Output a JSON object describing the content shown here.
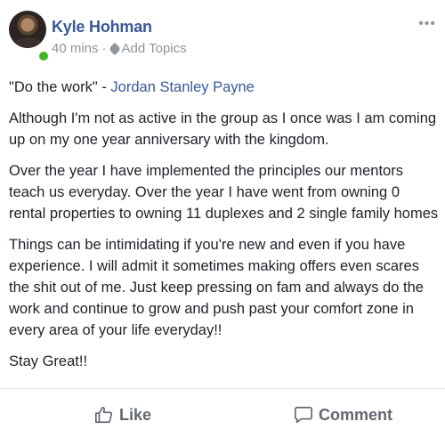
{
  "post": {
    "author": "Kyle Hohman",
    "time": "40 mins",
    "separator": "·",
    "add_topics": "Add Topics",
    "more": "•••",
    "quote": "\"Do the work\" - ",
    "mention": "Jordan Stanley Payne",
    "paragraph1": "Although I'm not as active in the group as I once was I am coming up on my one year anniversary with the kingdom.",
    "paragraph2": "Over the year I have implemented the principles our mentors teach us everyday. Over the year I have went from owning 0 rental properties to owning 11 duplexes and 2 single family homes",
    "paragraph3": "Things can be intimidating if you're new and even if you have experience. I will admit it sometimes making offers even scares the shit out of me. Just keep pressing on fam and always do the work and continue to grow and push past your comfort zone in every area of your life everyday!!",
    "paragraph4": "Stay Great!!"
  },
  "actions": {
    "like": "Like",
    "comment": "Comment"
  },
  "colors": {
    "link": "#385898",
    "muted": "#90949c",
    "text": "#1d2129",
    "online": "#42b72a"
  },
  "icons": {
    "like": "thumbs-up-icon",
    "comment": "speech-bubble-icon",
    "topics": "tag-icon",
    "more": "ellipsis-icon"
  }
}
